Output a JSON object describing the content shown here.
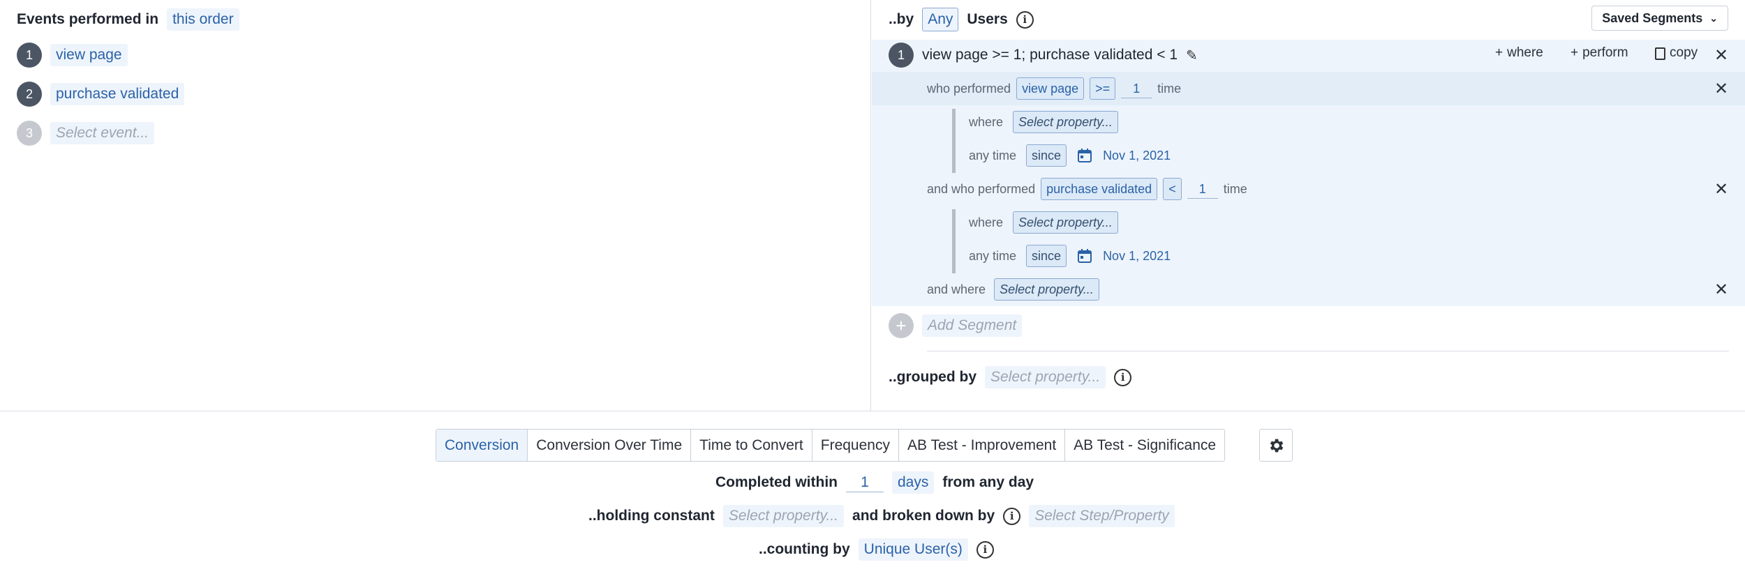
{
  "left": {
    "header_label": "Events performed in",
    "order_value": "this order",
    "events": [
      {
        "index": "1",
        "name": "view page"
      },
      {
        "index": "2",
        "name": "purchase validated"
      }
    ],
    "next_event": {
      "index": "3",
      "placeholder": "Select event..."
    }
  },
  "right": {
    "by_label": "..by",
    "any_label": "Any",
    "users_label": "Users",
    "saved_segments": "Saved Segments",
    "segment": {
      "index": "1",
      "title": "view page >= 1; purchase validated < 1",
      "actions": {
        "where": "where",
        "perform": "perform",
        "copy": "copy"
      },
      "conditions": [
        {
          "prefix": "who performed",
          "event": "view page",
          "operator": ">=",
          "count": "1",
          "unit": "time",
          "where_label": "where",
          "where_placeholder": "Select property...",
          "time_label": "any time",
          "since_label": "since",
          "date": "Nov 1, 2021"
        },
        {
          "prefix": "and who performed",
          "event": "purchase validated",
          "operator": "<",
          "count": "1",
          "unit": "time",
          "where_label": "where",
          "where_placeholder": "Select property...",
          "time_label": "any time",
          "since_label": "since",
          "date": "Nov 1, 2021"
        }
      ],
      "and_where_label": "and where",
      "and_where_placeholder": "Select property..."
    },
    "add_segment": "Add Segment",
    "grouped_by_label": "..grouped by",
    "grouped_by_placeholder": "Select property..."
  },
  "bottom": {
    "tabs": [
      "Conversion",
      "Conversion Over Time",
      "Time to Convert",
      "Frequency",
      "AB Test - Improvement",
      "AB Test - Significance"
    ],
    "active_tab": "Conversion",
    "completed_within_label": "Completed within",
    "completed_value": "1",
    "completed_unit": "days",
    "completed_suffix": "from any day",
    "holding_constant_label": "..holding constant",
    "holding_placeholder": "Select property...",
    "broken_down_label": "and broken down by",
    "broken_down_placeholder": "Select Step/Property",
    "counting_by_label": "..counting by",
    "counting_value": "Unique User(s)"
  },
  "colors": {
    "accent": "#2a62a8",
    "segment_bg": "#eef4fb",
    "step_circle": "#4b5563"
  }
}
